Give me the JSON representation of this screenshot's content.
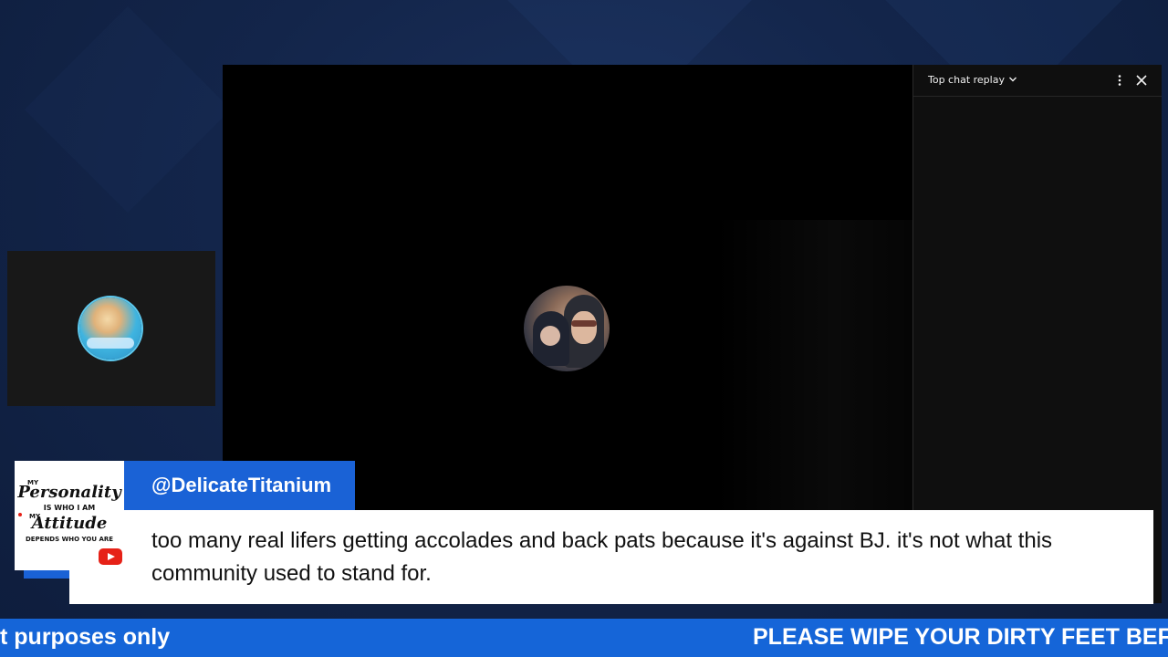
{
  "chat_panel": {
    "title": "Top chat replay"
  },
  "comment": {
    "username": "@DelicateTitanium",
    "text": "too many real lifers getting accolades and back pats because it's against BJ. it's not what this community used to stand for."
  },
  "profile_card": {
    "line_my_1": "MY",
    "line_personality": "Personality",
    "line_is_who": "IS WHO I AM",
    "line_my_2": "MY",
    "line_attitude": "Attitude",
    "line_depends": "DEPENDS WHO YOU ARE"
  },
  "ticker": {
    "text_left": "t purposes only",
    "text_right": "PLEASE WIPE YOUR DIRTY FEET BEF"
  },
  "colors": {
    "accent_blue": "#1a62d6",
    "ticker_blue": "#1565d8",
    "background": "#13254a",
    "chat_bg": "#0f0f0f"
  },
  "icons": [
    "chevron-down-icon",
    "more-vert-icon",
    "close-icon",
    "youtube-logo-icon"
  ]
}
